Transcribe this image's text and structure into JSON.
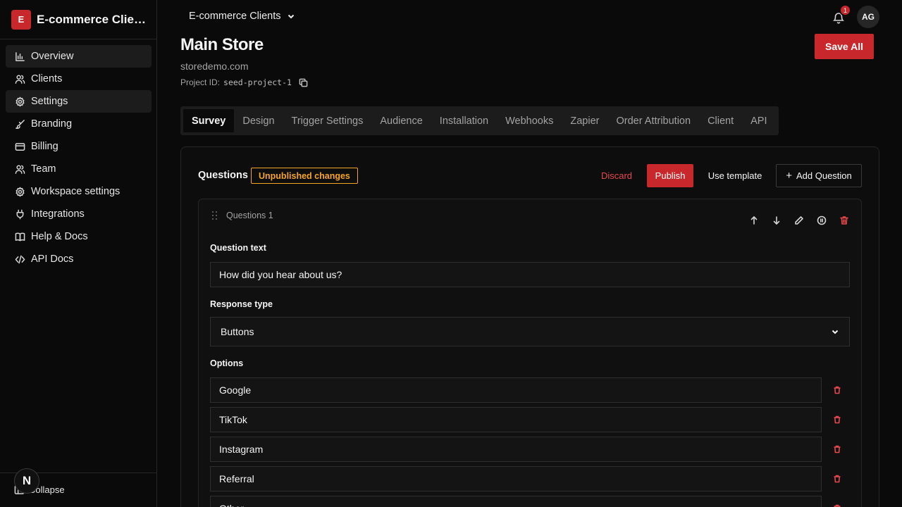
{
  "sidebar": {
    "brand_initial": "E",
    "brand_name": "E-commerce Clients",
    "items": [
      {
        "label": "Overview",
        "icon": "bar-chart-icon",
        "active": true
      },
      {
        "label": "Clients",
        "icon": "users-icon",
        "active": false
      },
      {
        "label": "Settings",
        "icon": "gear-icon",
        "active": true
      },
      {
        "label": "Branding",
        "icon": "brush-icon",
        "active": false
      },
      {
        "label": "Billing",
        "icon": "credit-card-icon",
        "active": false
      },
      {
        "label": "Team",
        "icon": "users-icon",
        "active": false
      },
      {
        "label": "Workspace settings",
        "icon": "gear-icon",
        "active": false
      },
      {
        "label": "Integrations",
        "icon": "plug-icon",
        "active": false
      },
      {
        "label": "Help & Docs",
        "icon": "book-icon",
        "active": false
      },
      {
        "label": "API Docs",
        "icon": "code-icon",
        "active": false
      }
    ],
    "collapse_label": "Collapse",
    "next_badge": "N"
  },
  "topbar": {
    "workspace": "E-commerce Clients",
    "notification_count": "1",
    "avatar_initials": "AG"
  },
  "header": {
    "title": "Main Store",
    "domain": "storedemo.com",
    "project_id_label": "Project ID:",
    "project_id": "seed-project-1",
    "save_all": "Save All"
  },
  "tabs": [
    "Survey",
    "Design",
    "Trigger Settings",
    "Audience",
    "Installation",
    "Webhooks",
    "Zapier",
    "Order Attribution",
    "Client",
    "API"
  ],
  "active_tab": "Survey",
  "survey": {
    "section_title": "Questions",
    "status_badge": "Unpublished changes",
    "discard": "Discard",
    "publish": "Publish",
    "use_template": "Use template",
    "add_question": "Add Question",
    "question": {
      "label": "Questions 1",
      "question_text_label": "Question text",
      "question_text": "How did you hear about us?",
      "response_type_label": "Response type",
      "response_type": "Buttons",
      "options_label": "Options",
      "options": [
        "Google",
        "TikTok",
        "Instagram",
        "Referral",
        "Other"
      ]
    }
  },
  "colors": {
    "accent": "#c8282b",
    "warning": "#f5a524",
    "danger": "#e5484d",
    "background": "#0a0a0a"
  }
}
